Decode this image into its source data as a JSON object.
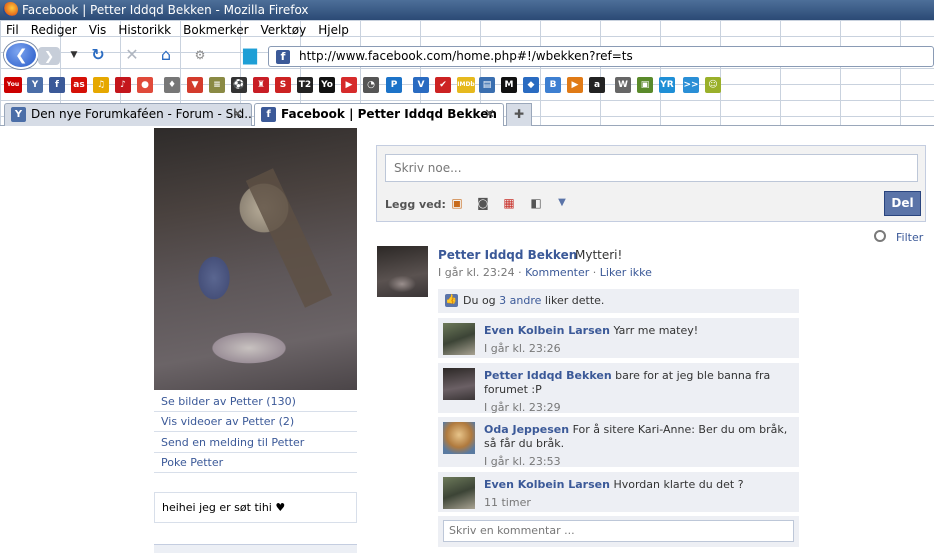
{
  "window": {
    "title": "Facebook | Petter Iddqd Bekken - Mozilla Firefox"
  },
  "menu": [
    "Fil",
    "Rediger",
    "Vis",
    "Historikk",
    "Bokmerker",
    "Verktøy",
    "Hjelp"
  ],
  "url": "http://www.facebook.com/home.php#!/wbekken?ref=ts",
  "bookmarks": [
    {
      "icon": "youtube-icon",
      "glyph": "You",
      "color": "#cc0000"
    },
    {
      "icon": "forum-icon",
      "glyph": "Y",
      "color": "#4b6ea8"
    },
    {
      "icon": "facebook-icon",
      "glyph": "f",
      "color": "#3b5998"
    },
    {
      "icon": "lastfm-icon",
      "glyph": "as",
      "color": "#d51007"
    },
    {
      "icon": "bookmark-icon",
      "glyph": "♫",
      "color": "#e6a800"
    },
    {
      "icon": "music-icon",
      "glyph": "♪",
      "color": "#c4161c"
    },
    {
      "icon": "bookmark-icon",
      "glyph": "●",
      "color": "#e04a3a"
    },
    {
      "icon": "bookmark-icon",
      "glyph": "♦",
      "color": "#777777"
    },
    {
      "icon": "bookmark-icon",
      "glyph": "▼",
      "color": "#d33b2c"
    },
    {
      "icon": "bookmark-icon",
      "glyph": "≡",
      "color": "#8a8a44"
    },
    {
      "icon": "bookmark-icon",
      "glyph": "⚽",
      "color": "#333333"
    },
    {
      "icon": "bookmark-icon",
      "glyph": "♜",
      "color": "#c81d25"
    },
    {
      "icon": "bookmark-icon",
      "glyph": "S",
      "color": "#cc2222"
    },
    {
      "icon": "bookmark-icon",
      "glyph": "T2",
      "color": "#222222"
    },
    {
      "icon": "bookmark-icon",
      "glyph": "Yo",
      "color": "#111111"
    },
    {
      "icon": "play-icon",
      "glyph": "▶",
      "color": "#d62b2b"
    },
    {
      "icon": "bookmark-icon",
      "glyph": "◔",
      "color": "#555555"
    },
    {
      "icon": "bookmark-icon",
      "glyph": "P",
      "color": "#1c73c8"
    },
    {
      "icon": "bookmark-icon",
      "glyph": "V",
      "color": "#2a6bc1"
    },
    {
      "icon": "bookmark-icon",
      "glyph": "✔",
      "color": "#cc2222"
    },
    {
      "icon": "imdb-icon",
      "glyph": "IMDb",
      "color": "#e6b91e"
    },
    {
      "icon": "bookmark-icon",
      "glyph": "▤",
      "color": "#3a6fb0"
    },
    {
      "icon": "bookmark-icon",
      "glyph": "M",
      "color": "#111111"
    },
    {
      "icon": "bookmark-icon",
      "glyph": "◆",
      "color": "#2a6bc1"
    },
    {
      "icon": "bookmark-icon",
      "glyph": "B",
      "color": "#3d7fd1"
    },
    {
      "icon": "bookmark-icon",
      "glyph": "▶",
      "color": "#e07a16"
    },
    {
      "icon": "amazon-icon",
      "glyph": "a",
      "color": "#222222"
    },
    {
      "icon": "wikipedia-icon",
      "glyph": "W",
      "color": "#666666"
    },
    {
      "icon": "bookmark-icon",
      "glyph": "▣",
      "color": "#5a8a2a"
    },
    {
      "icon": "yr-icon",
      "glyph": "YR",
      "color": "#1f8fd6"
    },
    {
      "icon": "arrows-icon",
      "glyph": ">>",
      "color": "#2a8fd6"
    },
    {
      "icon": "bookmark-icon",
      "glyph": "☺",
      "color": "#9ab02a"
    }
  ],
  "tabs": [
    {
      "label": "Den nye Forumkaféen - Forum - Sid...",
      "active": false
    },
    {
      "label": "Facebook | Petter Iddqd Bekken",
      "active": true
    }
  ],
  "sidebar": {
    "links": [
      "Se bilder av Petter (130)",
      "Vis videoer av Petter (2)",
      "Send en melding til Petter",
      "Poke Petter"
    ],
    "bio": "heihei jeg er søt tihi ♥"
  },
  "composer": {
    "placeholder": "Skriv noe...",
    "attach_label": "Legg ved:",
    "share_label": "Del"
  },
  "filter_label": "Filter",
  "post": {
    "author": "Petter Iddqd Bekken",
    "text": "Mytteri!",
    "time": "I går kl. 23:24",
    "separator": " · ",
    "comment_link": "Kommenter",
    "like_link": "Liker ikke",
    "likes_prefix": "Du og ",
    "likes_link": "3 andre",
    "likes_suffix": " liker dette."
  },
  "comments": [
    {
      "author": "Even Kolbein Larsen",
      "text": "Yarr me matey!",
      "time": "I går kl. 23:26"
    },
    {
      "author": "Petter Iddqd Bekken",
      "text": "bare for at jeg ble banna fra forumet :P",
      "time": "I går kl. 23:29"
    },
    {
      "author": "Oda Jeppesen",
      "text": "For å sitere Kari-Anne: Ber du om bråk, så får du bråk.",
      "time": "I går kl. 23:53"
    },
    {
      "author": "Even Kolbein Larsen",
      "text": "Hvordan klarte du det ?",
      "time": "11 timer"
    }
  ],
  "comment_placeholder": "Skriv en kommentar ..."
}
